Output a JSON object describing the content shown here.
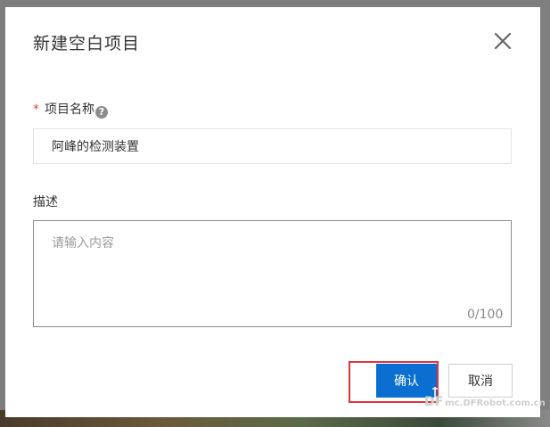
{
  "dialog": {
    "title": "新建空白项目",
    "close_icon": "close-icon"
  },
  "form": {
    "name_field": {
      "required_mark": "*",
      "label": "项目名称",
      "help_icon": "question-circle-icon",
      "help_glyph": "?",
      "value": "阿峰的检测装置"
    },
    "description_field": {
      "label": "描述",
      "placeholder": "请输入内容",
      "value": "",
      "char_count": "0/100"
    }
  },
  "actions": {
    "confirm_label": "确认",
    "cancel_label": "取消"
  },
  "watermark": {
    "brand": "DF",
    "site": "mc.DFRobot.com.cn"
  },
  "colors": {
    "primary": "#0a6fd1",
    "required": "#e0483c",
    "highlight": "#e0333a"
  }
}
